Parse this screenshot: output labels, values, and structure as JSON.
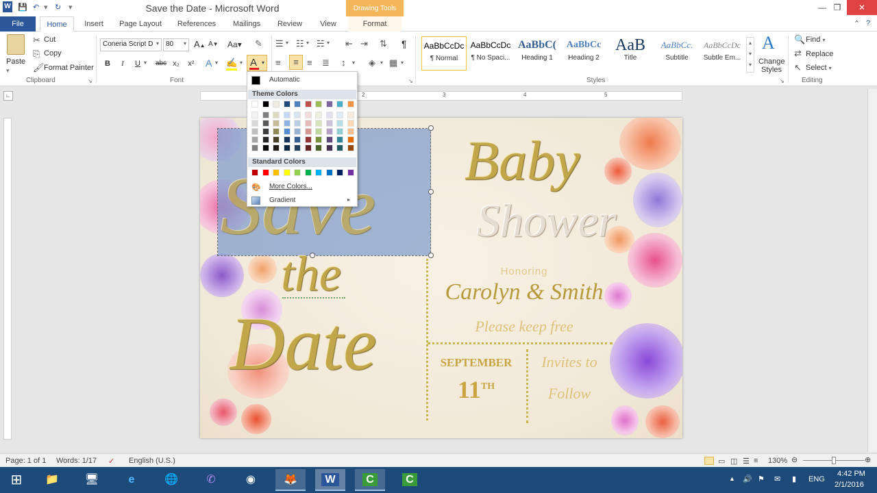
{
  "window": {
    "title": "Save the Date - Microsoft Word",
    "contextual_tab_group": "Drawing Tools",
    "app_icon": "word-icon"
  },
  "quick_access": {
    "save": "save-icon",
    "undo": "undo-icon",
    "redo": "redo-icon"
  },
  "tabs": [
    "File",
    "Home",
    "Insert",
    "Page Layout",
    "References",
    "Mailings",
    "Review",
    "View",
    "Format"
  ],
  "active_tab": "Home",
  "clipboard": {
    "paste_label": "Paste",
    "cut_label": "Cut",
    "copy_label": "Copy",
    "format_painter_label": "Format Painter",
    "group_label": "Clipboard"
  },
  "font": {
    "font_name": "Coneria Script D",
    "font_size": "80",
    "group_label": "Font",
    "bold": "B",
    "italic": "I",
    "underline": "U",
    "strike": "abc",
    "subscript": "x₂",
    "superscript": "x²",
    "grow": "A",
    "shrink": "A",
    "case": "Aa"
  },
  "paragraph": {
    "group_label": "Paragraph",
    "pilcrow": "¶"
  },
  "styles": {
    "group_label": "Styles",
    "items": [
      {
        "sample": "AaBbCcDc",
        "name": "¶ Normal"
      },
      {
        "sample": "AaBbCcDc",
        "name": "¶ No Spaci..."
      },
      {
        "sample": "AaBbC(",
        "name": "Heading 1"
      },
      {
        "sample": "AaBbCc",
        "name": "Heading 2"
      },
      {
        "sample": "AaB",
        "name": "Title"
      },
      {
        "sample": "AaBbCc.",
        "name": "Subtitle"
      },
      {
        "sample": "AaBbCcDc",
        "name": "Subtle Em..."
      }
    ],
    "change_styles_line1": "Change",
    "change_styles_line2": "Styles"
  },
  "editing": {
    "group_label": "Editing",
    "find": "Find",
    "replace": "Replace",
    "select": "Select"
  },
  "ruler_numbers": [
    "1",
    "2",
    "3",
    "4",
    "5"
  ],
  "color_menu": {
    "automatic": "Automatic",
    "theme_header": "Theme Colors",
    "standard_header": "Standard Colors",
    "more_colors": "More Colors...",
    "gradient": "Gradient",
    "theme_top": [
      "#ffffff",
      "#000000",
      "#eeece1",
      "#1f497d",
      "#4f81bd",
      "#c0504d",
      "#9bbb59",
      "#8064a2",
      "#4bacc6",
      "#f79646"
    ],
    "theme_shades": [
      [
        "#f2f2f2",
        "#7f7f7f",
        "#ddd9c3",
        "#c6d9f0",
        "#dbe5f1",
        "#f2dcdb",
        "#ebf1dd",
        "#e5e0ec",
        "#dbeef3",
        "#fdeada"
      ],
      [
        "#d8d8d8",
        "#595959",
        "#c4bd97",
        "#8db3e2",
        "#b8cce4",
        "#e5b9b7",
        "#d7e3bc",
        "#ccc1d9",
        "#b7dde8",
        "#fbd5b5"
      ],
      [
        "#bfbfbf",
        "#3f3f3f",
        "#938953",
        "#548dd4",
        "#95b3d7",
        "#d99694",
        "#c3d69b",
        "#b2a2c7",
        "#92cddc",
        "#fac08f"
      ],
      [
        "#a5a5a5",
        "#262626",
        "#494429",
        "#17365d",
        "#366092",
        "#953734",
        "#76923c",
        "#5f497a",
        "#31859b",
        "#e36c09"
      ],
      [
        "#7f7f7f",
        "#0c0c0c",
        "#1d1b10",
        "#0f243e",
        "#244061",
        "#632423",
        "#4f6128",
        "#3f3151",
        "#205867",
        "#974806"
      ]
    ],
    "standard": [
      "#c00000",
      "#ff0000",
      "#ffc000",
      "#ffff00",
      "#92d050",
      "#00b050",
      "#00b0f0",
      "#0070c0",
      "#002060",
      "#7030a0"
    ]
  },
  "document": {
    "save": "Save",
    "the": "the",
    "date": "Date",
    "baby": "Baby",
    "shower": "Shower",
    "honoring": "Honoring",
    "name": "Carolyn & Smith",
    "keep_free": "Please keep free",
    "month": "SEPTEMBER",
    "day": "11",
    "day_suffix": "TH",
    "invites_line1": "Invites to",
    "invites_line2": "Follow"
  },
  "status": {
    "page": "Page: 1 of 1",
    "words": "Words: 1/17",
    "language": "English (U.S.)",
    "zoom": "130%"
  },
  "taskbar": {
    "language": "ENG",
    "time": "4:42 PM",
    "date": "2/1/2016"
  },
  "colors": {
    "word_blue": "#2b579a",
    "drawing_tools": "#f3b65a",
    "gold_text": "#c2a64a",
    "selection_fill": "#7a9acc",
    "taskbar": "#1e4a7a"
  }
}
